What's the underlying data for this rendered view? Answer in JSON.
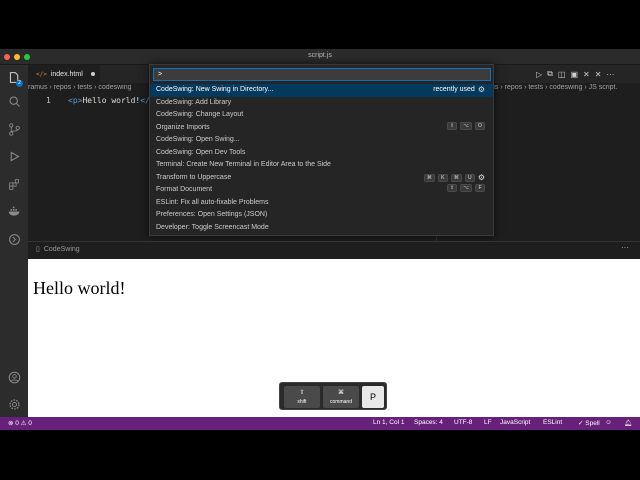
{
  "window": {
    "title": "script.js"
  },
  "colors": {
    "accent": "#0e70c0",
    "statusbar": "#68217a",
    "selection": "#04395e"
  },
  "activitybar": {
    "icons": [
      "files-icon",
      "search-icon",
      "source-control-icon",
      "run-debug-icon",
      "extensions-icon",
      "docker-icon",
      "remote-icon",
      "account-icon",
      "settings-gear-icon"
    ],
    "badge": "2"
  },
  "tabs": [
    {
      "label": "index.html",
      "modified": true
    }
  ],
  "breadcrumb": {
    "left": "ramus › repos › tests › codeswing",
    "right": "us › repos › tests › codeswing › JS script."
  },
  "editor": {
    "line_number": "1",
    "code_open": "<p>",
    "code_text": "Hello world!",
    "code_close": "</"
  },
  "palette": {
    "input_value": ">",
    "items": [
      {
        "label": "CodeSwing: New Swing in Directory...",
        "right_text": "recently used",
        "gear": true,
        "keys": []
      },
      {
        "label": "CodeSwing: Add Library",
        "keys": []
      },
      {
        "label": "CodeSwing: Change Layout",
        "keys": []
      },
      {
        "label": "Organize Imports",
        "keys": [
          "⇧",
          "⌥",
          "O"
        ]
      },
      {
        "label": "CodeSwing: Open Swing...",
        "keys": []
      },
      {
        "label": "CodeSwing: Open Dev Tools",
        "keys": []
      },
      {
        "label": "Terminal: Create New Terminal in Editor Area to the Side",
        "keys": []
      },
      {
        "label": "Transform to Uppercase",
        "keys": [
          "⌘",
          "K",
          "⌘",
          "U"
        ],
        "gear": true
      },
      {
        "label": "Format Document",
        "keys": [
          "⇧",
          "⌥",
          "F"
        ]
      },
      {
        "label": "ESLint: Fix all auto-fixable Problems",
        "keys": []
      },
      {
        "label": "Preferences: Open Settings (JSON)",
        "keys": []
      },
      {
        "label": "Developer: Toggle Screencast Mode",
        "keys": []
      }
    ]
  },
  "panel": {
    "tab": "CodeSwing",
    "more": "···"
  },
  "preview": {
    "text": "Hello world!"
  },
  "keyhud": [
    {
      "symbol": "⇧",
      "label": "shift"
    },
    {
      "symbol": "⌘",
      "label": "command"
    },
    {
      "symbol": "",
      "label": "P"
    }
  ],
  "statusbar": {
    "problems": "⊗ 0 ⚠ 0",
    "position": "Ln 1, Col 1",
    "spaces": "Spaces: 4",
    "encoding": "UTF-8",
    "eol": "LF",
    "language": "JavaScript",
    "eslint": "ESLint",
    "spell": "✓ Spell"
  }
}
